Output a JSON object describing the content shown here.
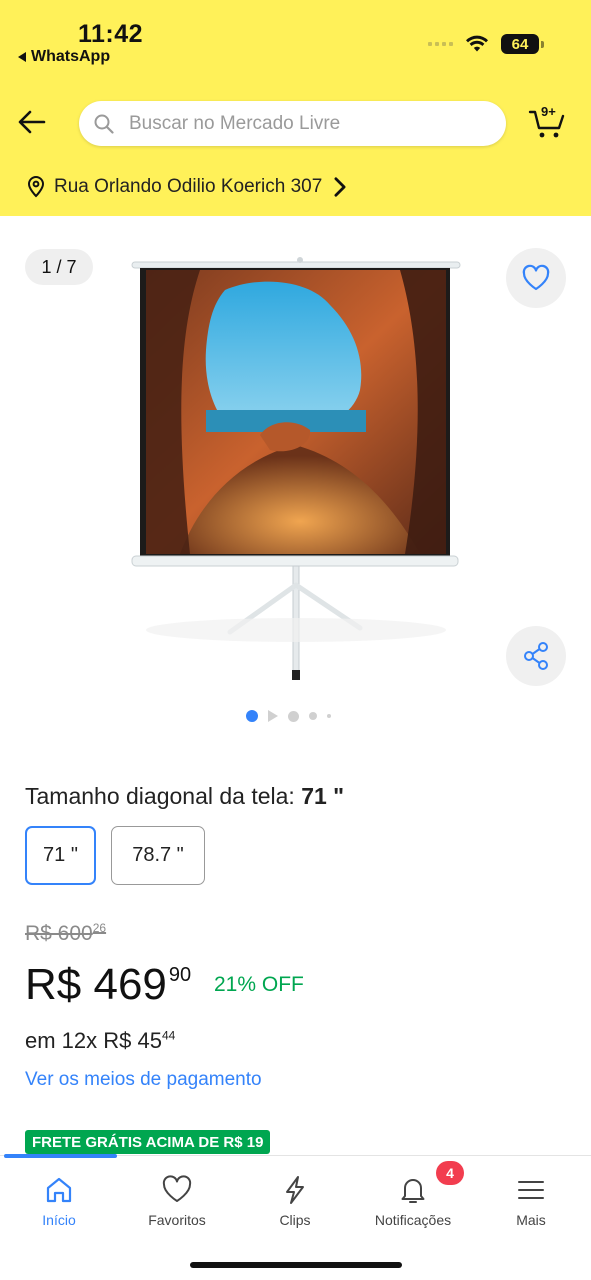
{
  "status_bar": {
    "time": "11:42",
    "back_app": "WhatsApp",
    "battery": "64"
  },
  "header": {
    "search_placeholder": "Buscar no Mercado Livre",
    "cart_count": "9+",
    "address": "Rua Orlando Odilio Koerich 307"
  },
  "gallery": {
    "counter": "1 / 7",
    "current_index": 1,
    "total_images": 7
  },
  "variant": {
    "label": "Tamanho diagonal da tela:",
    "selected": "71 \"",
    "options": [
      "71 \"",
      "78.7 \""
    ]
  },
  "price": {
    "old_integer": "R$ 600",
    "old_cents": "26",
    "currency": "R$",
    "integer": "469",
    "cents": "90",
    "discount": "21% OFF",
    "installments_prefix": "em 12x R$ 45",
    "installments_cents": "44",
    "payment_link": "Ver os meios de pagamento",
    "shipping_badge": "FRETE GRÁTIS ACIMA DE R$ 19"
  },
  "tabbar": {
    "items": [
      {
        "label": "Início",
        "icon": "home-icon",
        "active": true
      },
      {
        "label": "Favoritos",
        "icon": "heart-icon",
        "active": false
      },
      {
        "label": "Clips",
        "icon": "lightning-icon",
        "active": false
      },
      {
        "label": "Notificações",
        "icon": "bell-icon",
        "active": false
      },
      {
        "label": "Mais",
        "icon": "menu-icon",
        "active": false
      }
    ],
    "notifications_badge": "4"
  },
  "colors": {
    "header_bg": "#fff159",
    "accent_blue": "#3483fa",
    "discount_green": "#00a650",
    "badge_red": "#f23d4f"
  }
}
